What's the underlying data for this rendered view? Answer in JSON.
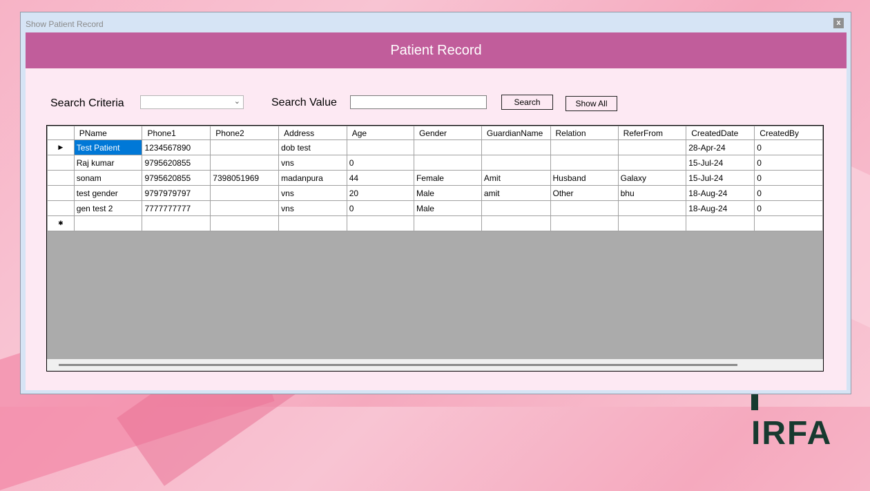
{
  "window": {
    "title": "Show Patient Record",
    "close_label": "x"
  },
  "header": {
    "title": "Patient Record"
  },
  "search": {
    "criteria_label": "Search Criteria",
    "criteria_value": "",
    "value_label": "Search Value",
    "value_text": "",
    "search_button": "Search",
    "show_all_button": "Show All"
  },
  "grid": {
    "columns": [
      "PName",
      "Phone1",
      "Phone2",
      "Address",
      "Age",
      "Gender",
      "GuardianName",
      "Relation",
      "ReferFrom",
      "CreatedDate",
      "CreatedBy"
    ],
    "rows": [
      [
        "Test Patient",
        "1234567890",
        "",
        "dob test",
        "",
        "",
        "",
        "",
        "",
        "28-Apr-24",
        "0"
      ],
      [
        "Raj kumar",
        "9795620855",
        "",
        "vns",
        "0",
        "",
        "",
        "",
        "",
        "15-Jul-24",
        "0"
      ],
      [
        "sonam",
        "9795620855",
        "7398051969",
        "madanpura",
        "44",
        "Female",
        "Amit",
        "Husband",
        "Galaxy",
        "15-Jul-24",
        "0"
      ],
      [
        "test gender",
        "9797979797",
        "",
        "vns",
        "20",
        "Male",
        "amit",
        "Other",
        "bhu",
        "18-Aug-24",
        "0"
      ],
      [
        "gen test 2",
        "7777777777",
        "",
        "vns",
        "0",
        "Male",
        "",
        "",
        "",
        "18-Aug-24",
        "0"
      ]
    ],
    "current_row_marker": "▶",
    "new_row_marker": "✱"
  },
  "background": {
    "logo_text": "IRFA"
  }
}
